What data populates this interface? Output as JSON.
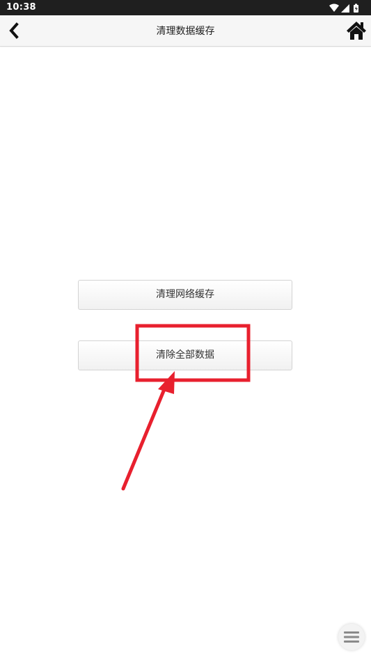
{
  "status_bar": {
    "time": "10:38",
    "icons": [
      "wifi-icon",
      "cellular-signal-icon",
      "battery-icon"
    ]
  },
  "header": {
    "title": "清理数据缓存",
    "back_icon": "chevron-left-icon",
    "home_icon": "home-icon"
  },
  "actions": {
    "clear_network_cache_label": "清理网络缓存",
    "clear_all_data_label": "清除全部数据"
  },
  "annotation": {
    "color": "#e8202e",
    "highlight_target": "clear-all-data-button"
  },
  "floating_menu": {
    "icon": "menu-icon"
  }
}
